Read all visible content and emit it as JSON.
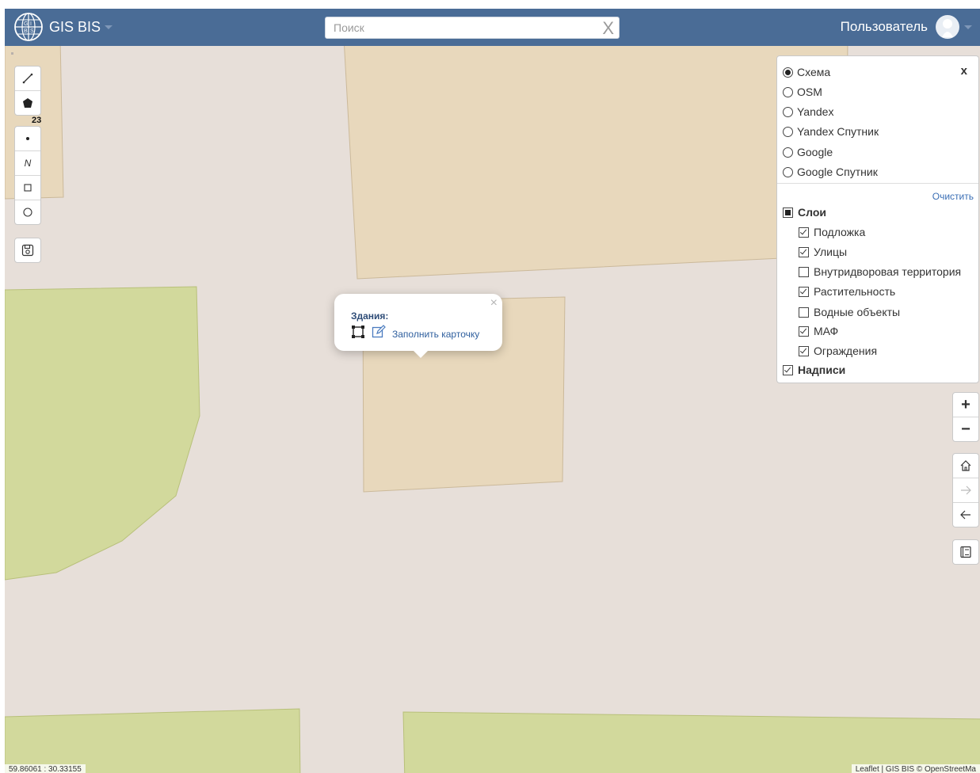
{
  "header": {
    "brand": "GIS BIS",
    "search_placeholder": "Поиск",
    "search_clear": "X",
    "user_label": "Пользователь"
  },
  "draw_toolbar": {
    "line_icon": "line-icon",
    "polygon_icon": "polygon-icon",
    "count": "23",
    "point_icon": "point-icon",
    "polyline_label": "N",
    "rectangle_icon": "rectangle-icon",
    "circle_icon": "circle-icon",
    "save_icon": "save-icon"
  },
  "layers_panel": {
    "close": "x",
    "basemaps": [
      {
        "label": "Схема",
        "selected": true
      },
      {
        "label": "OSM",
        "selected": false
      },
      {
        "label": "Yandex",
        "selected": false
      },
      {
        "label": "Yandex Спутник",
        "selected": false
      },
      {
        "label": "Google",
        "selected": false
      },
      {
        "label": "Google Спутник",
        "selected": false
      }
    ],
    "clear_label": "Очистить",
    "layers_group": {
      "label": "Слои",
      "state": "partial"
    },
    "layers": [
      {
        "label": "Подложка",
        "checked": true
      },
      {
        "label": "Улицы",
        "checked": true
      },
      {
        "label": "Внутридворовая территория",
        "checked": false
      },
      {
        "label": "Растительность",
        "checked": true
      },
      {
        "label": "Водные объекты",
        "checked": false
      },
      {
        "label": "МАФ",
        "checked": true
      },
      {
        "label": "Ограждения",
        "checked": true
      }
    ],
    "labels_group": {
      "label": "Надписи",
      "checked": true
    }
  },
  "map_controls": {
    "zoom_in": "+",
    "zoom_out": "−",
    "home_icon": "home-icon",
    "forward_icon": "arrow-right-icon",
    "back_icon": "arrow-left-icon",
    "legend_icon": "book-icon"
  },
  "popup": {
    "close": "×",
    "title": "Здания:",
    "link": "Заполнить карточку"
  },
  "status": {
    "coordinates": "59.86061 : 30.33155",
    "attribution": "Leaflet | GIS BIS © OpenStreetMa"
  },
  "colors": {
    "navbar": "#4a6c96",
    "map_bg": "#e7dfd9",
    "building": "#e8d8bc",
    "vegetation": "#d2d99c"
  }
}
